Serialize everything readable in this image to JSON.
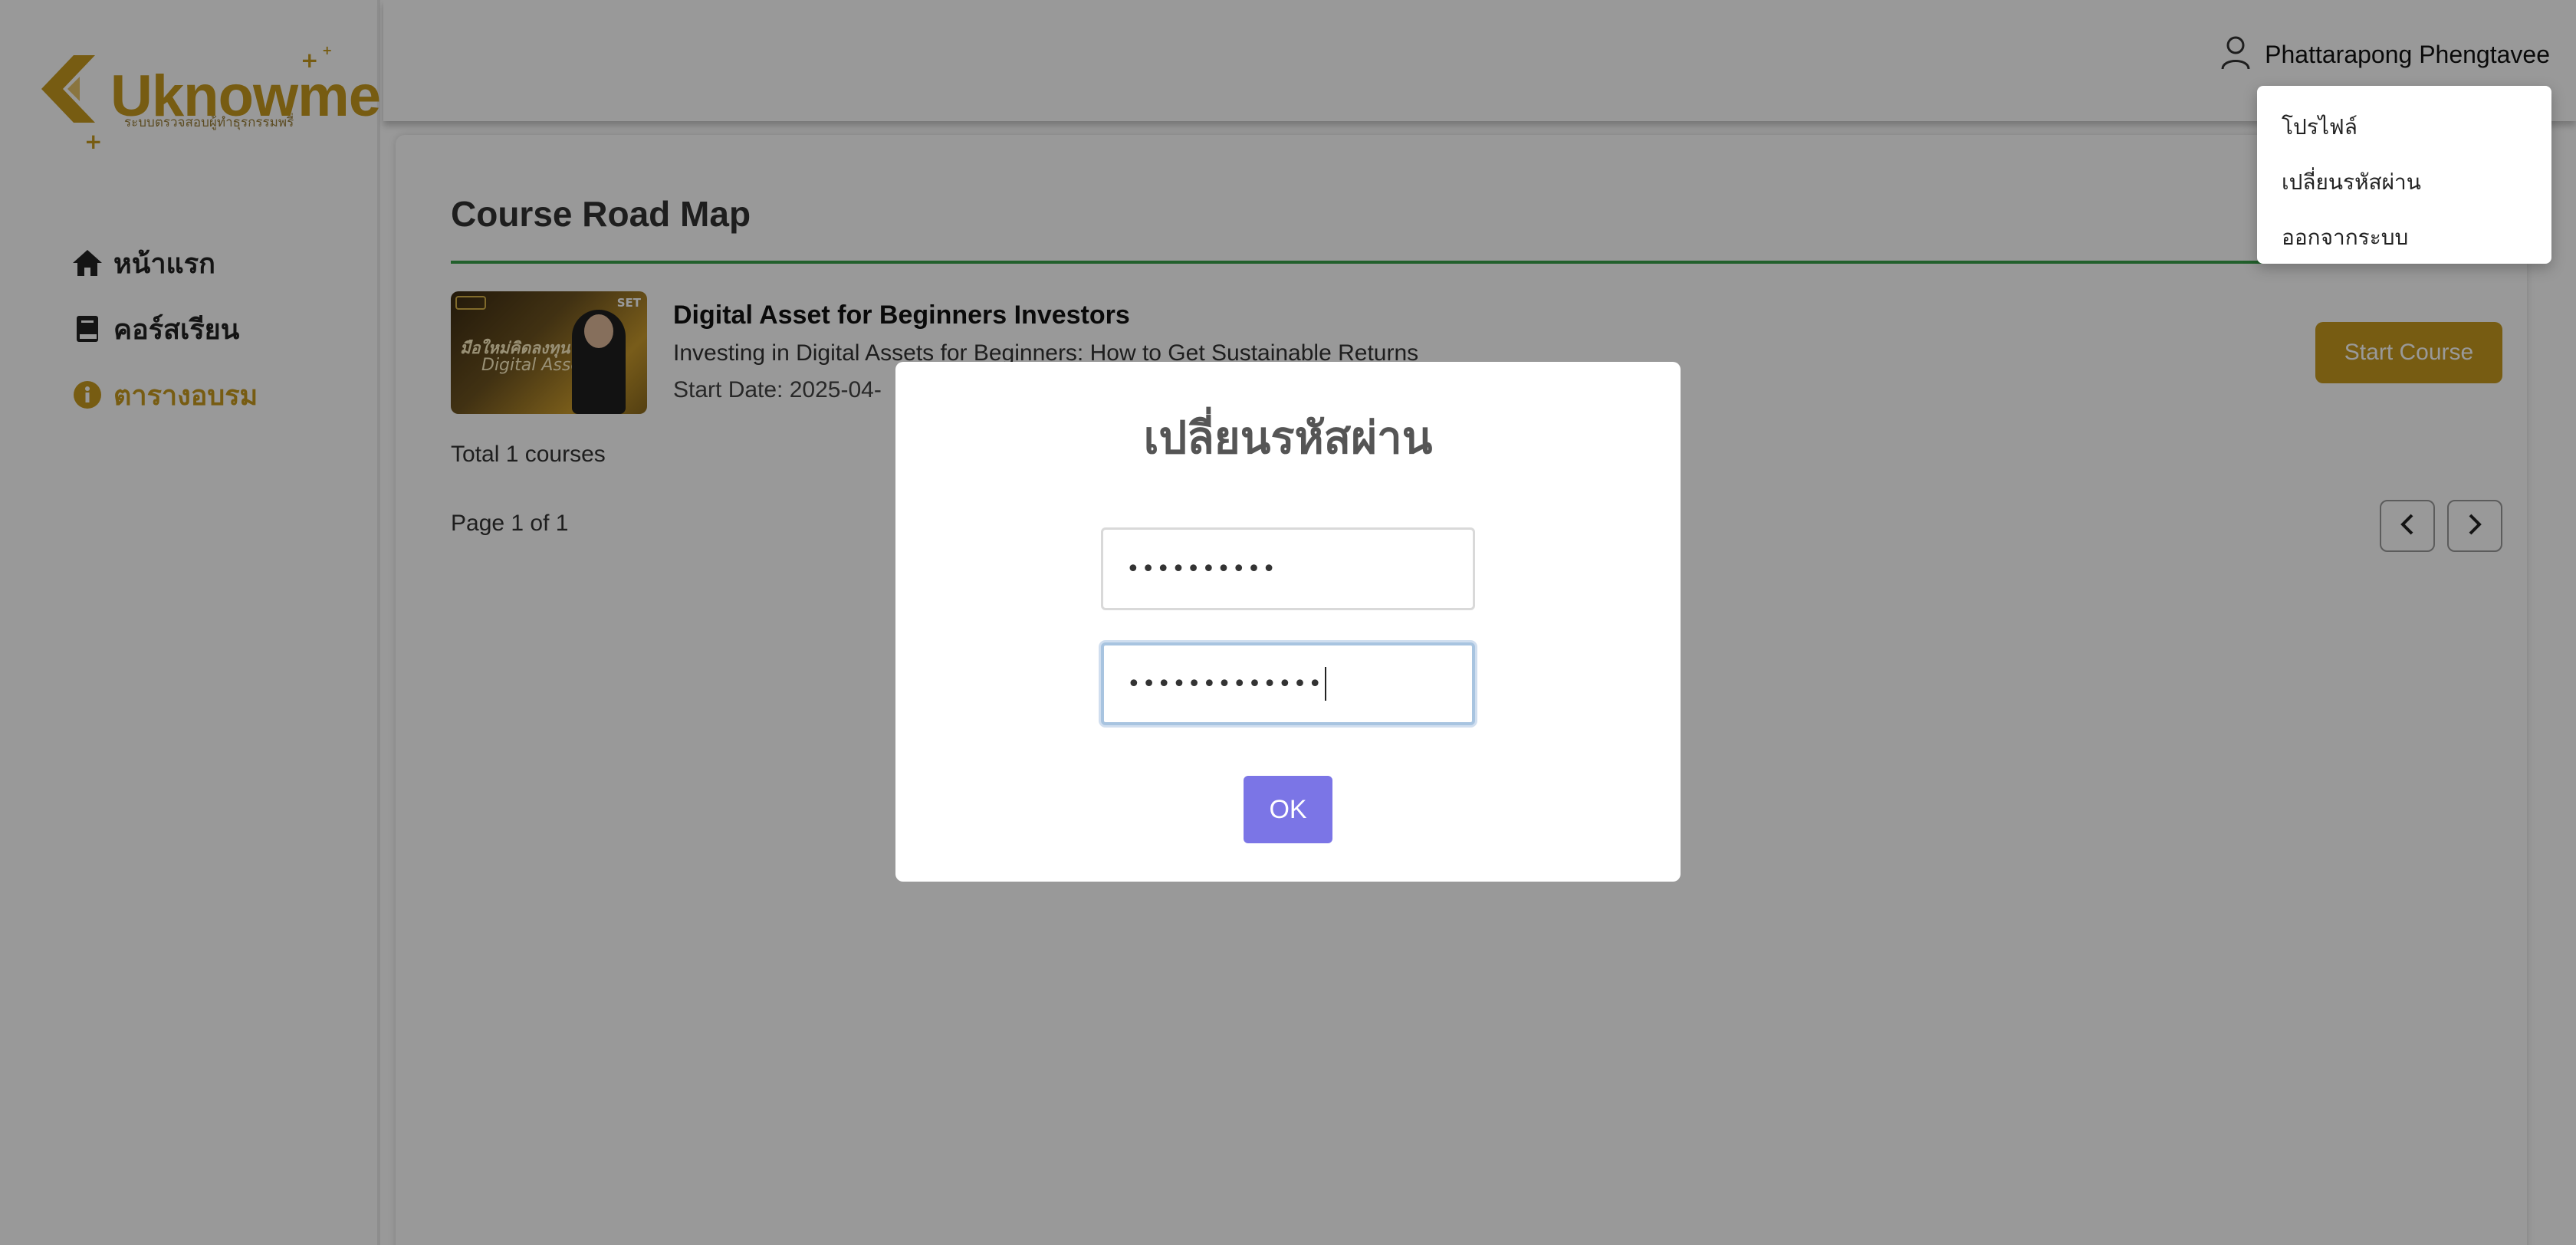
{
  "brand": {
    "name": "Uknowme",
    "tagline": "ระบบตรวจสอบผู้ทำธุรกรรมพรี่",
    "accent_color": "#c79a1e"
  },
  "sidebar": {
    "items": [
      {
        "label": "หน้าแรก",
        "icon": "home-icon",
        "active": false
      },
      {
        "label": "คอร์สเรียน",
        "icon": "book-icon",
        "active": false
      },
      {
        "label": "ตารางอบรม",
        "icon": "info-icon",
        "active": true
      }
    ]
  },
  "header": {
    "user_name": "Phattarapong Phengtavee",
    "user_icon": "user-icon"
  },
  "user_menu": {
    "items": [
      "โปรไฟล์",
      "เปลี่ยนรหัสผ่าน",
      "ออกจากระบบ"
    ]
  },
  "main": {
    "title": "Course Road Map",
    "rule_color": "#3aa04a",
    "course": {
      "title": "Digital Asset for Beginners Investors",
      "description": "Investing in Digital Assets for Beginners: How to Get Sustainable Returns",
      "start_date": "Start Date: 2025-04-",
      "thumbnail_text_1": "มือใหม่คิดลงทุน",
      "thumbnail_text_2": "Digital Asset",
      "thumbnail_badge": "SET",
      "start_button": "Start Course"
    },
    "total": "Total 1 courses",
    "page_info": "Page 1 of 1"
  },
  "modal": {
    "title": "เปลี่ยนรหัสผ่าน",
    "field1_value": "••••••••••",
    "field2_value": "•••••••••••••",
    "ok_label": "OK",
    "ok_color": "#7b75e6"
  }
}
